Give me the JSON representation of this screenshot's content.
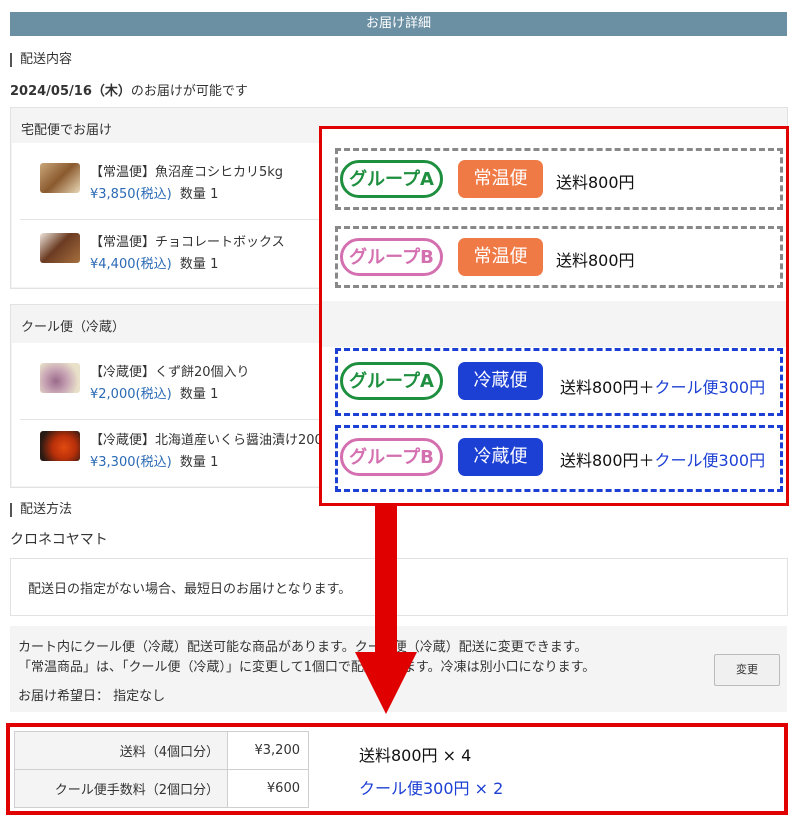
{
  "header": {
    "title": "お届け詳細"
  },
  "delivery_content": {
    "section_label": "配送内容",
    "date": "2024/05/16（木）",
    "date_suffix": "のお届けが可能です"
  },
  "packages": [
    {
      "title": "宅配便でお届け",
      "items": [
        {
          "name": "【常温便】魚沼産コシヒカリ5kg",
          "price": "¥3,850",
          "tax": "(税込)",
          "qty_label": "数量",
          "qty": "1"
        },
        {
          "name": "【常温便】チョコレートボックス",
          "price": "¥4,400",
          "tax": "(税込)",
          "qty_label": "数量",
          "qty": "1"
        }
      ]
    },
    {
      "title": "クール便（冷蔵）",
      "items": [
        {
          "name": "【冷蔵便】くず餅20個入り",
          "price": "¥2,000",
          "tax": "(税込)",
          "qty_label": "数量",
          "qty": "1"
        },
        {
          "name": "【冷蔵便】北海道産いくら醤油漬け200g",
          "price": "¥3,300",
          "tax": "(税込)",
          "qty_label": "数量",
          "qty": "1"
        }
      ]
    }
  ],
  "shipping_method": {
    "section_label": "配送方法",
    "carrier": "クロネコヤマト",
    "note": "配送日の指定がない場合、最短日のお届けとなります。"
  },
  "info": {
    "line1": "カート内にクール便（冷蔵）配送可能な商品があります。クール便（冷蔵）配送に変更できます。",
    "line2": "「常温商品」は、「クール便（冷蔵）」に変更して1個口で配送できます。冷凍は別小口になります。",
    "desired_date": "お届け希望日： 指定なし",
    "change_button": "変更"
  },
  "overlay": {
    "rows": [
      {
        "group": "グループA",
        "type": "常温便",
        "fee": "送料800円",
        "cool": ""
      },
      {
        "group": "グループB",
        "type": "常温便",
        "fee": "送料800円",
        "cool": ""
      },
      {
        "group": "グループA",
        "type": "冷蔵便",
        "fee": "送料800円＋",
        "cool": "クール便300円"
      },
      {
        "group": "グループB",
        "type": "冷蔵便",
        "fee": "送料800円＋",
        "cool": "クール便300円"
      }
    ]
  },
  "summary": {
    "rows": [
      {
        "label": "送料（4個口分）",
        "value": "¥3,200",
        "calc": "送料800円 × 4"
      },
      {
        "label": "クール便手数料（2個口分）",
        "value": "¥600",
        "calc": "クール便300円 × 2"
      }
    ]
  },
  "colors": {
    "header": "#6b8fa3",
    "highlight_red": "#e00000",
    "group_a": "#1e8f3e",
    "group_b": "#d46fb0",
    "ambient_tag": "#f07a45",
    "chilled_tag": "#1c3fd4",
    "price_blue": "#2a6ab5"
  }
}
